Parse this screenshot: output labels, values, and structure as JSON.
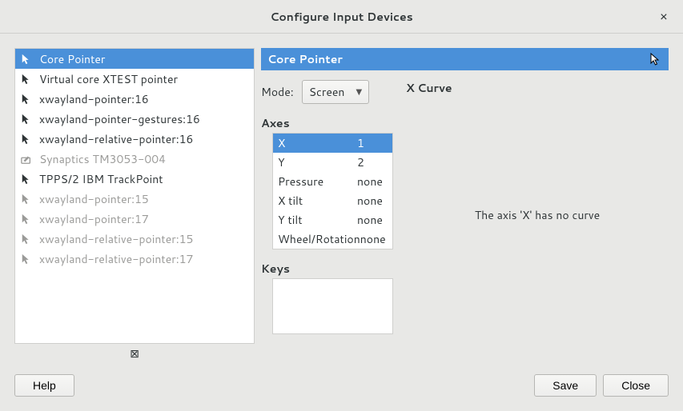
{
  "window": {
    "title": "Configure Input Devices",
    "close_glyph": "×"
  },
  "devices": [
    {
      "name": "Core Pointer",
      "icon": "cursor",
      "faded": false,
      "selected": true
    },
    {
      "name": "Virtual core XTEST pointer",
      "icon": "cursor",
      "faded": false,
      "selected": false
    },
    {
      "name": "xwayland-pointer:16",
      "icon": "cursor",
      "faded": false,
      "selected": false
    },
    {
      "name": "xwayland-pointer-gestures:16",
      "icon": "cursor",
      "faded": false,
      "selected": false
    },
    {
      "name": "xwayland-relative-pointer:16",
      "icon": "cursor",
      "faded": false,
      "selected": false
    },
    {
      "name": "Synaptics TM3053-004",
      "icon": "tablet",
      "faded": true,
      "selected": false
    },
    {
      "name": "TPPS/2 IBM TrackPoint",
      "icon": "cursor",
      "faded": false,
      "selected": false
    },
    {
      "name": "xwayland-pointer:15",
      "icon": "cursor",
      "faded": true,
      "selected": false
    },
    {
      "name": "xwayland-pointer:17",
      "icon": "cursor",
      "faded": true,
      "selected": false
    },
    {
      "name": "xwayland-relative-pointer:15",
      "icon": "cursor",
      "faded": true,
      "selected": false
    },
    {
      "name": "xwayland-relative-pointer:17",
      "icon": "cursor",
      "faded": true,
      "selected": false
    }
  ],
  "toolbar_remove_glyph": "⊠",
  "detail": {
    "title": "Core Pointer",
    "mode_label": "Mode:",
    "mode_value": "Screen",
    "axes_label": "Axes",
    "axes": [
      {
        "name": "X",
        "value": "1",
        "selected": true
      },
      {
        "name": "Y",
        "value": "2",
        "selected": false
      },
      {
        "name": "Pressure",
        "value": "none",
        "selected": false
      },
      {
        "name": "X tilt",
        "value": "none",
        "selected": false
      },
      {
        "name": "Y tilt",
        "value": "none",
        "selected": false
      },
      {
        "name": "Wheel/Rotation",
        "value": "none",
        "selected": false
      }
    ],
    "keys_label": "Keys",
    "curve_label": "X Curve",
    "curve_message": "The axis 'X' has no curve"
  },
  "buttons": {
    "help": "Help",
    "save": "Save",
    "close": "Close"
  }
}
